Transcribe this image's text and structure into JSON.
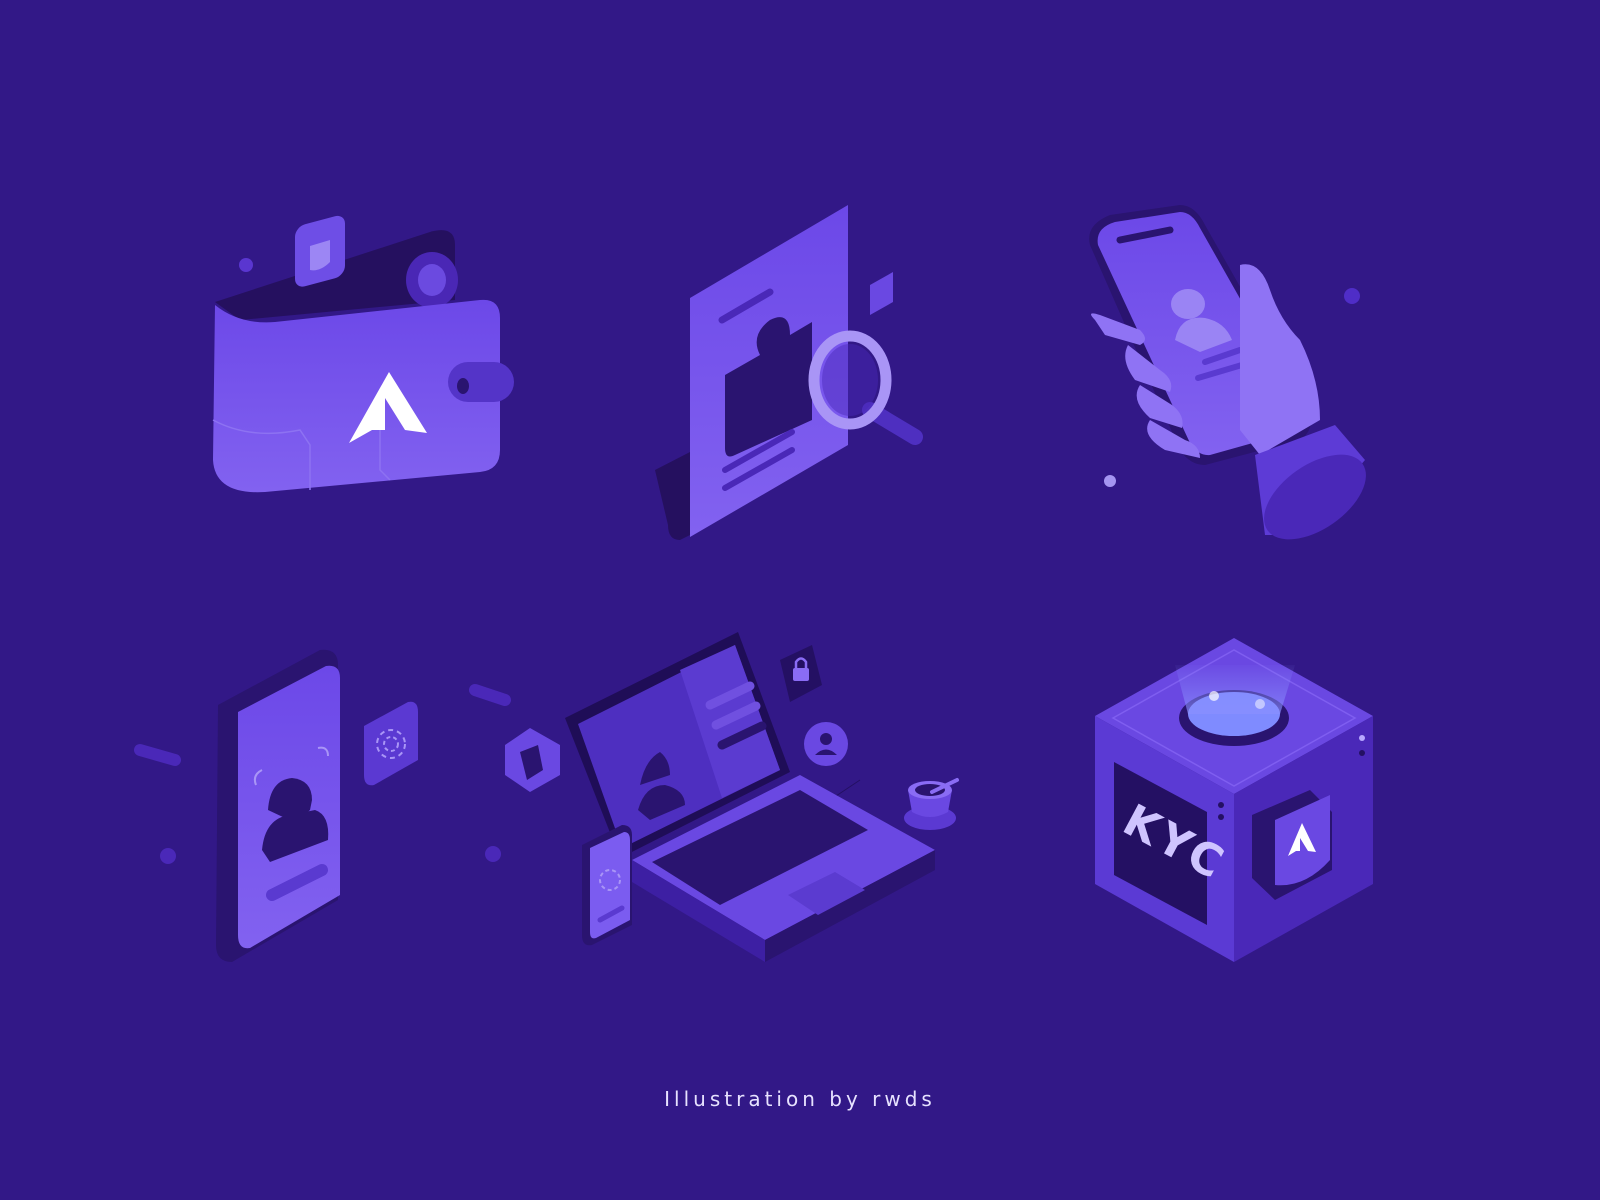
{
  "page": {
    "background_color": "#321887",
    "caption": "Illustration by rwds"
  },
  "illustrations": [
    {
      "name": "wallet",
      "icons": [
        "shield-icon",
        "brand-logo-icon"
      ]
    },
    {
      "name": "id-document-search",
      "icons": [
        "magnifier-icon",
        "puzzle-piece-icon"
      ]
    },
    {
      "name": "hand-holding-phone",
      "icons": [
        "user-profile-icon"
      ]
    },
    {
      "name": "phone-face-scan",
      "icons": [
        "face-scan-icon",
        "fingerprint-icon"
      ]
    },
    {
      "name": "laptop-verification",
      "icons": [
        "lock-icon",
        "shield-icon",
        "user-icon",
        "coffee-cup-icon"
      ]
    },
    {
      "name": "kyc-cube",
      "icons": [
        "brand-logo-icon",
        "shield-icon"
      ],
      "label": "KYC"
    }
  ],
  "colors": {
    "accent": "#6a45e6",
    "accent_light": "#8a6cf5",
    "dark": "#241063",
    "glow": "#7f8bff"
  }
}
